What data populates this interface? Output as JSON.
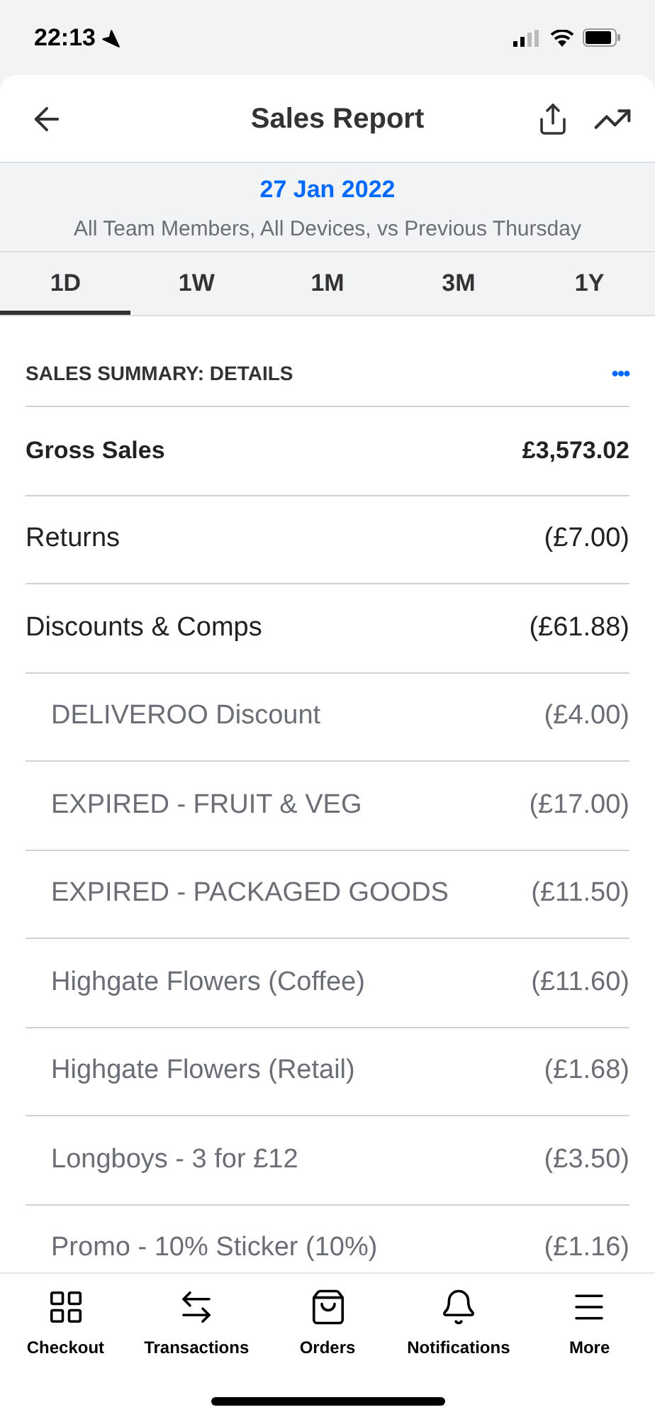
{
  "status_bar": {
    "time": "22:13"
  },
  "header": {
    "title": "Sales Report"
  },
  "filter": {
    "date": "27 Jan 2022",
    "description": "All Team Members, All Devices, vs Previous Thursday"
  },
  "tabs": [
    {
      "label": "1D",
      "selected": true
    },
    {
      "label": "1W",
      "selected": false
    },
    {
      "label": "1M",
      "selected": false
    },
    {
      "label": "3M",
      "selected": false
    },
    {
      "label": "1Y",
      "selected": false
    }
  ],
  "section": {
    "title": "SALES SUMMARY: DETAILS",
    "more": "•••"
  },
  "rows": [
    {
      "kind": "total",
      "label": "Gross Sales",
      "value": "£3,573.02"
    },
    {
      "kind": "line",
      "label": "Returns",
      "value": "(£7.00)"
    },
    {
      "kind": "line",
      "label": "Discounts & Comps",
      "value": "(£61.88)"
    },
    {
      "kind": "sub",
      "label": "DELIVEROO Discount",
      "value": "(£4.00)"
    },
    {
      "kind": "sub",
      "label": "EXPIRED - FRUIT & VEG",
      "value": "(£17.00)"
    },
    {
      "kind": "sub",
      "label": "EXPIRED - PACKAGED GOODS",
      "value": "(£11.50)"
    },
    {
      "kind": "sub",
      "label": "Highgate Flowers (Coffee)",
      "value": "(£11.60)"
    },
    {
      "kind": "sub",
      "label": "Highgate Flowers (Retail)",
      "value": "(£1.68)"
    },
    {
      "kind": "sub",
      "label": "Longboys - 3 for £12",
      "value": "(£3.50)"
    },
    {
      "kind": "sub",
      "label": "Promo - 10% Sticker (10%)",
      "value": "(£1.16)"
    }
  ],
  "nav": [
    {
      "label": "Checkout"
    },
    {
      "label": "Transactions"
    },
    {
      "label": "Orders"
    },
    {
      "label": "Notifications"
    },
    {
      "label": "More"
    }
  ]
}
